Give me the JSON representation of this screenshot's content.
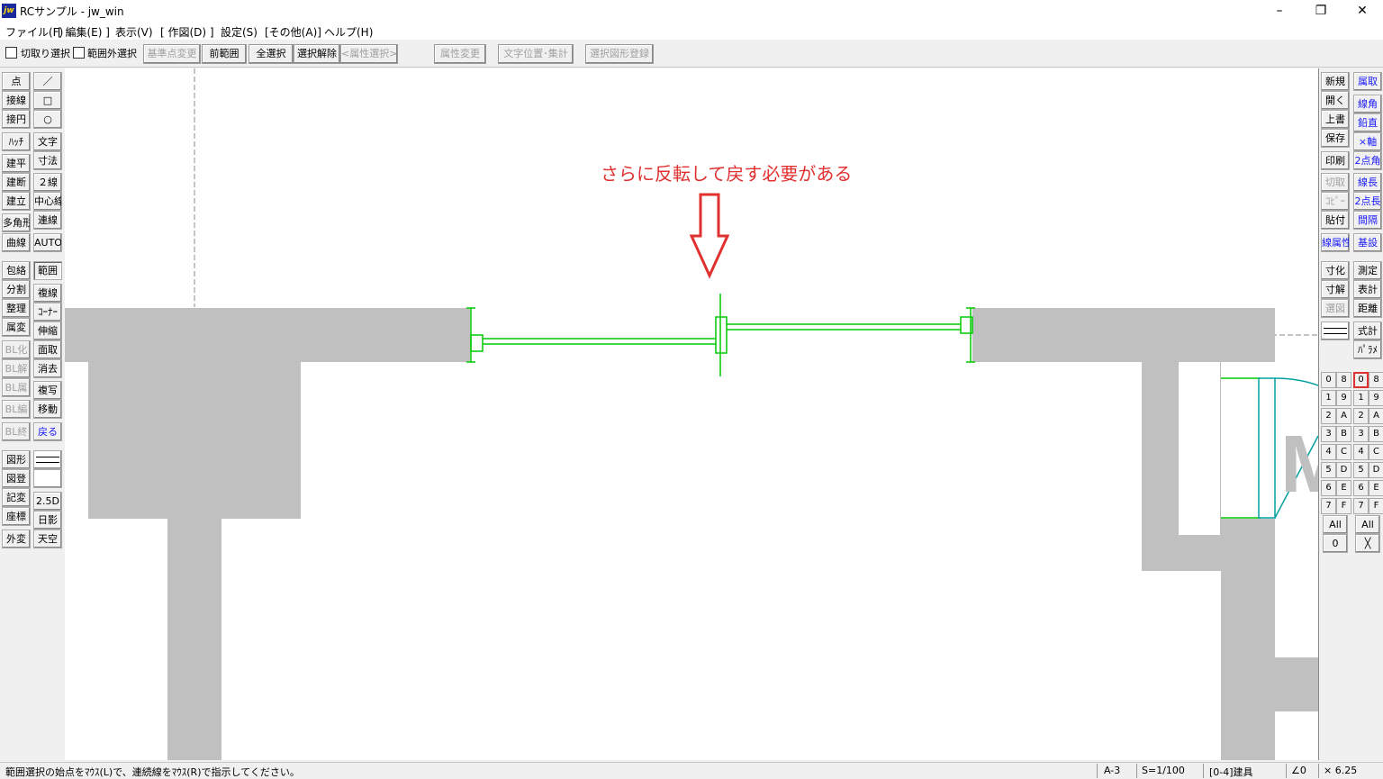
{
  "window": {
    "title": "RCサンプル - jw_win",
    "icon_text": "jw",
    "minimize": "–",
    "restore": "❐",
    "close": "✕"
  },
  "menu": [
    "ファイル(F)",
    "[ 編集(E) ]",
    "表示(V)",
    "[ 作図(D) ]",
    "設定(S)",
    "[その他(A)]",
    "ヘルプ(H)"
  ],
  "toolbar": {
    "cut_select": "切取り選択",
    "outside_select": "範囲外選択",
    "base_point_change": "基準点変更",
    "prev_range": "前範囲",
    "select_all": "全選択",
    "deselect": "選択解除",
    "attr_select": "<属性選択>",
    "attr_change": "属性変更",
    "text_pos_total": "文字位置･集計",
    "register_shape": "選択図形登録"
  },
  "left_tools": {
    "col1": [
      "点",
      "接線",
      "接円",
      "ﾊｯﾁ",
      "建平",
      "建断",
      "建立",
      "多角形",
      "曲線",
      "包絡",
      "分割",
      "整理",
      "属変",
      "BL化",
      "BL解",
      "BL属",
      "BL編",
      "BL終",
      "図形",
      "図登",
      "記変",
      "座標",
      "外変"
    ],
    "col2": [
      "／",
      "□",
      "○",
      "文字",
      "寸法",
      "２線",
      "中心線",
      "連線",
      "AUTO",
      "範囲",
      "複線",
      "ｺｰﾅｰ",
      "伸縮",
      "面取",
      "消去",
      "複写",
      "移動",
      "戻る",
      "",
      "",
      "2.5D",
      "日影",
      "天空"
    ]
  },
  "right_tools": {
    "col1": [
      "新規",
      "開く",
      "上書",
      "保存",
      "印刷",
      "切取",
      "ｺﾋﾟｰ",
      "貼付",
      "線属性",
      "寸化",
      "寸解",
      "選図",
      "",
      ""
    ],
    "col2": [
      "属取",
      "線角",
      "鉛直",
      "×軸",
      "2点角",
      "線長",
      "2点長",
      "間隔",
      "基設",
      "測定",
      "表計",
      "距離",
      "式計",
      "ﾊﾟﾗﾒ"
    ]
  },
  "layers": {
    "group_left": [
      "0",
      "1",
      "2",
      "3",
      "4",
      "5",
      "6",
      "7"
    ],
    "group_left_b": [
      "8",
      "9",
      "A",
      "B",
      "C",
      "D",
      "E",
      "F"
    ],
    "group_right": [
      "0",
      "1",
      "2",
      "3",
      "4",
      "5",
      "6",
      "7"
    ],
    "group_right_b": [
      "8",
      "9",
      "A",
      "B",
      "C",
      "D",
      "E",
      "F"
    ],
    "all_left": "All",
    "all_right": "All",
    "zero": "0",
    "cross": "╳"
  },
  "canvas": {
    "annotation": "さらに反転して戻す必要がある",
    "annotation_color": "#e03030",
    "wall_color": "#c0c0c0",
    "line_color": "#00c800",
    "large_letter": "M"
  },
  "status": {
    "message": "範囲選択の始点をﾏｳｽ(L)で、連続線をﾏｳｽ(R)で指示してください。",
    "paper": "A-3",
    "scale": "S=1/100",
    "layer": "[0-4]建具",
    "angle": "∠0",
    "cursor": "× 6.25"
  }
}
